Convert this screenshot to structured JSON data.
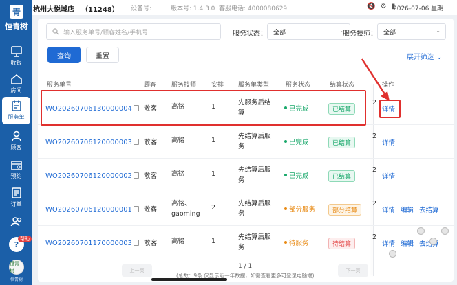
{
  "topbar": {
    "store_name": "杭州大悦城店",
    "store_id": "（11248）",
    "device_no": "设备号:",
    "version": "版本号: 1.4.3.0",
    "service_phone": "客服电话: 4000080629",
    "status_icons": "🔇 ⚙ ▮",
    "datetime": "2026-07-06 星期一"
  },
  "sidebar": {
    "logo_char": "青",
    "brand": "恒青树",
    "items": [
      {
        "label": "收银",
        "icon": "cashier-monitor-icon"
      },
      {
        "label": "房间",
        "icon": "home-icon"
      },
      {
        "label": "服务单",
        "icon": "service-order-icon",
        "active": true
      },
      {
        "label": "顾客",
        "icon": "customer-icon"
      },
      {
        "label": "预约",
        "icon": "calendar-icon"
      },
      {
        "label": "订单",
        "icon": "order-list-icon"
      },
      {
        "label": "",
        "icon": "users-icon"
      }
    ],
    "help_badge": "帮助",
    "help_icon": "help-icon",
    "avatar_text": "恒青树",
    "avatar_label": "恒青树"
  },
  "filters": {
    "search_placeholder": "输入服务单号/顾客姓名/手机号",
    "status_label": "服务状态：",
    "status_value": "全部",
    "tech_label": "服务技师：",
    "tech_value": "全部",
    "query_button": "查询",
    "reset_button": "重置",
    "expand_filter": "展开筛选 ⌄"
  },
  "table": {
    "columns": [
      "服务单号",
      "顾客",
      "服务技师",
      "安排",
      "服务单类型",
      "服务状态",
      "结算状态",
      "操作"
    ],
    "rows": [
      {
        "order_id": "WO20260706130000004",
        "customer": "散客",
        "technician": "高铭",
        "count": "1",
        "type_line1": "先服务后结",
        "type_line2": "算",
        "status": "已完成",
        "status_color": "#19a86b",
        "settle": "已结算",
        "settle_style": "green",
        "ops": [
          "详情"
        ],
        "cut": "2"
      },
      {
        "order_id": "WO20260706120000003",
        "customer": "散客",
        "technician": "高铭",
        "count": "1",
        "type_line1": "先结算后服",
        "type_line2": "务",
        "status": "已完成",
        "status_color": "#19a86b",
        "settle": "已结算",
        "settle_style": "green",
        "ops": [
          "详情"
        ],
        "cut": "2"
      },
      {
        "order_id": "WO20260706120000002",
        "customer": "散客",
        "technician": "高铭",
        "count": "1",
        "type_line1": "先结算后服",
        "type_line2": "务",
        "status": "已完成",
        "status_color": "#19a86b",
        "settle": "已结算",
        "settle_style": "green",
        "ops": [
          "详情"
        ],
        "cut": "2"
      },
      {
        "order_id": "WO20260706120000001",
        "customer": "散客",
        "technician": "高铭、",
        "technician2": "gaoming",
        "count": "2",
        "type_line1": "先结算后服",
        "type_line2": "务",
        "status": "部分服务",
        "status_color": "#e88a14",
        "settle": "部分结算",
        "settle_style": "orange",
        "ops": [
          "详情",
          "编辑",
          "去结算"
        ],
        "cut": "2"
      },
      {
        "order_id": "WO20260701170000003",
        "customer": "散客",
        "technician": "高铭",
        "count": "1",
        "type_line1": "先结算后服",
        "type_line2": "务",
        "status": "待服务",
        "status_color": "#e88a14",
        "settle": "待结算",
        "settle_style": "red",
        "ops": [
          "详情",
          "编辑",
          "去结算"
        ],
        "cut": "2"
      }
    ]
  },
  "pager": {
    "page": "1 / 1",
    "note": "(总数：9条 仅显示近一年数据，如需查看更多可登录电脑端)",
    "prev": "上一页",
    "next": "下一页"
  }
}
